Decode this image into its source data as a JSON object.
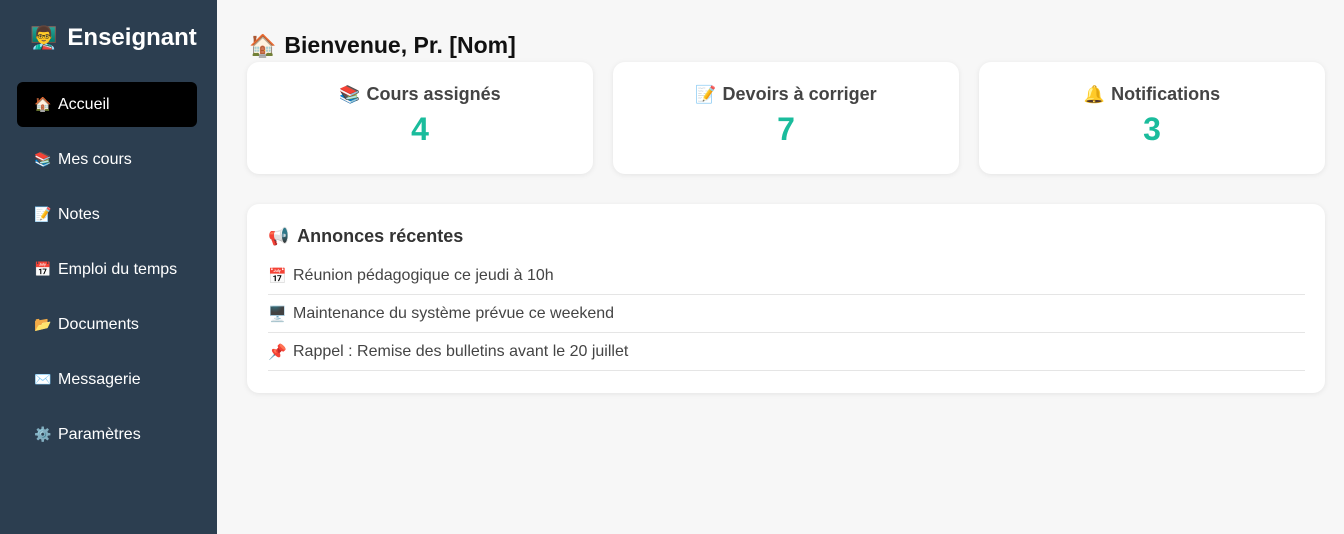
{
  "sidebar": {
    "brand_icon": "👨‍🏫",
    "brand": "Enseignant",
    "items": [
      {
        "icon": "🏠",
        "label": "Accueil",
        "active": true
      },
      {
        "icon": "📚",
        "label": "Mes cours"
      },
      {
        "icon": "📝",
        "label": "Notes"
      },
      {
        "icon": "📅",
        "label": "Emploi du temps"
      },
      {
        "icon": "📂",
        "label": "Documents"
      },
      {
        "icon": "✉️",
        "label": "Messagerie"
      },
      {
        "icon": "⚙️",
        "label": "Paramètres"
      }
    ]
  },
  "header": {
    "icon": "🏠",
    "title": "Bienvenue, Pr. [Nom]"
  },
  "cards": [
    {
      "icon": "📚",
      "label": "Cours assignés",
      "value": "4"
    },
    {
      "icon": "📝",
      "label": "Devoirs à corriger",
      "value": "7"
    },
    {
      "icon": "🔔",
      "label": "Notifications",
      "value": "3"
    }
  ],
  "annonces": {
    "icon": "📢",
    "title": "Annonces récentes",
    "items": [
      {
        "icon": "📅",
        "text": "Réunion pédagogique ce jeudi à 10h"
      },
      {
        "icon": "🖥️",
        "text": "Maintenance du système prévue ce weekend"
      },
      {
        "icon": "📌",
        "text": "Rappel : Remise des bulletins avant le 20 juillet"
      }
    ]
  },
  "colors": {
    "sidebar_bg": "#2c3e50",
    "active_item_bg": "#000000",
    "accent": "#1abc9c",
    "page_bg": "#f7f7f7"
  }
}
